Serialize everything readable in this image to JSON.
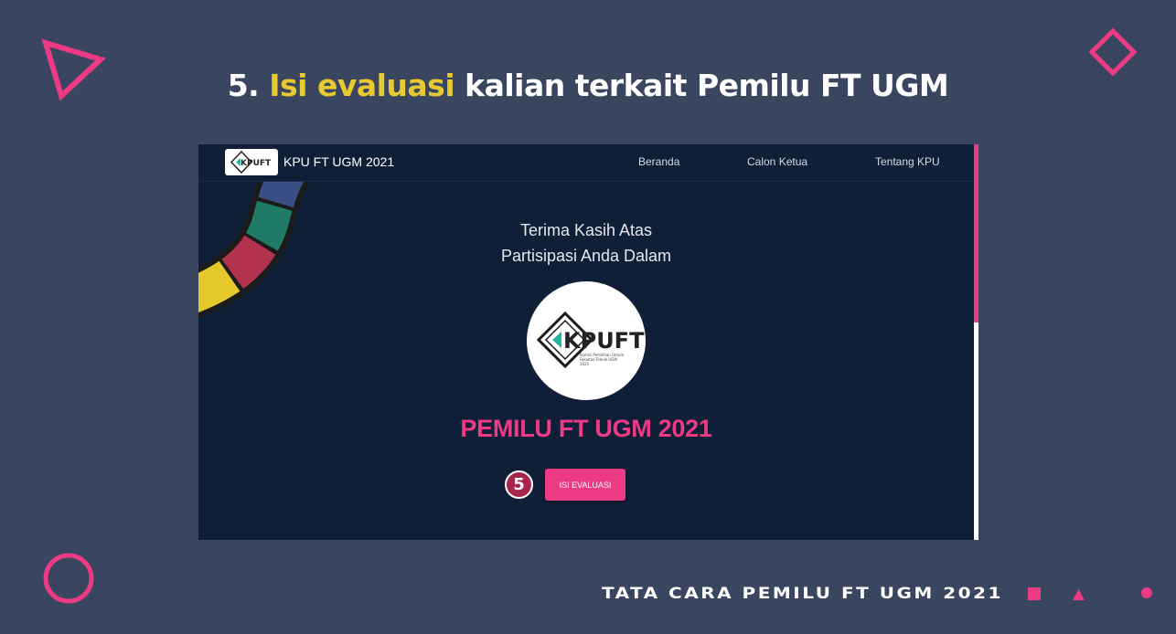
{
  "slide": {
    "title_prefix": "5. ",
    "title_highlight": "Isi evaluasi",
    "title_rest": " kalian terkait Pemilu FT UGM",
    "footer": "TATA CARA PEMILU FT UGM 2021",
    "step_marker": "5"
  },
  "site": {
    "brand": "KPU FT UGM 2021",
    "nav": [
      "Beranda",
      "Calon Ketua",
      "Tentang KPU"
    ],
    "thanks_line1": "Terima Kasih Atas",
    "thanks_line2": "Partisipasi Anda Dalam",
    "logo_text": "KPUFT",
    "logo_sub1": "Komisi Pemilihan Umum",
    "logo_sub2": "Fakultas Teknik UGM",
    "logo_sub3": "2021",
    "heading": "PEMILU FT UGM 2021",
    "button": "ISI EVALUASI"
  },
  "colors": {
    "background": "#3a465f",
    "accent_pink": "#ec3a85",
    "accent_yellow": "#e7c930",
    "site_bg": "#101f38"
  },
  "icons": [
    "triangle-outline-icon",
    "diamond-outline-icon",
    "circle-outline-icon",
    "square-icon",
    "triangle-icon",
    "dot-icon"
  ]
}
